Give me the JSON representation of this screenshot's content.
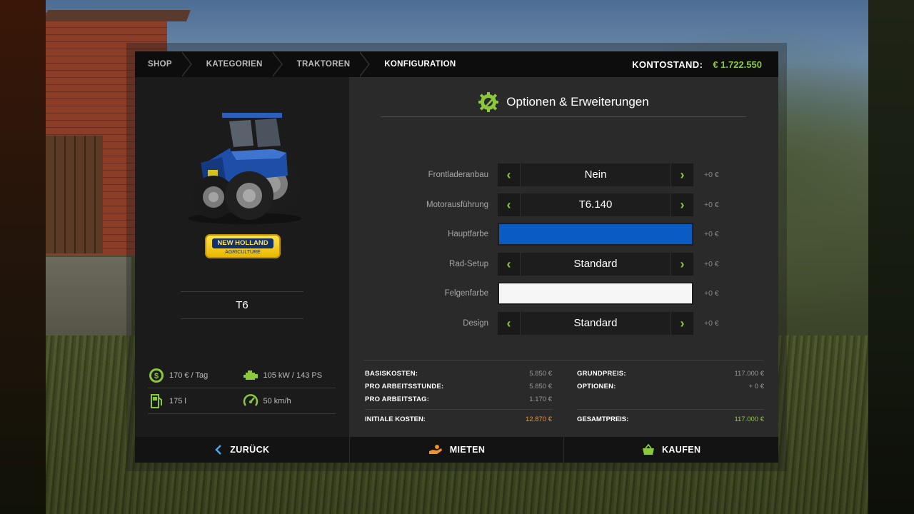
{
  "breadcrumbs": [
    "SHOP",
    "KATEGORIEN",
    "TRAKTOREN",
    "KONFIGURATION"
  ],
  "balance": {
    "label": "KONTOSTAND:",
    "value": "€ 1.722.550"
  },
  "vehicle": {
    "brand_line1": "NEW HOLLAND",
    "brand_line2": "AGRICULTURE",
    "model": "T6",
    "specs": {
      "cost_per_day": "170 € / Tag",
      "power": "105 kW / 143 PS",
      "fuel": "175 l",
      "speed": "50 km/h"
    }
  },
  "options": {
    "title": "Optionen & Erweiterungen",
    "rows": [
      {
        "label": "Frontladeranbau",
        "value": "Nein",
        "price": "+0 €"
      },
      {
        "label": "Motorausführung",
        "value": "T6.140",
        "price": "+0 €"
      },
      {
        "label": "Hauptfarbe",
        "color": "#0a5bc4",
        "price": "+0 €"
      },
      {
        "label": "Rad-Setup",
        "value": "Standard",
        "price": "+0 €"
      },
      {
        "label": "Felgenfarbe",
        "color": "#f6f6f6",
        "price": "+0 €"
      },
      {
        "label": "Design",
        "value": "Standard",
        "price": "+0 €"
      }
    ]
  },
  "costs": {
    "left": [
      {
        "k": "BASISKOSTEN:",
        "v": "5.850 €"
      },
      {
        "k": "PRO ARBEITSSTUNDE:",
        "v": "5.850 €"
      },
      {
        "k": "PRO ARBEITSTAG:",
        "v": "1.170 €"
      }
    ],
    "right": [
      {
        "k": "GRUNDPREIS:",
        "v": "117.000 €"
      },
      {
        "k": "OPTIONEN:",
        "v": "+ 0 €"
      }
    ],
    "initial_label": "INITIALE KOSTEN:",
    "initial_value": "12.870 €",
    "total_label": "GESAMTPREIS:",
    "total_value": "117.000 €"
  },
  "buttons": {
    "back": "ZURÜCK",
    "lease": "MIETEN",
    "buy": "KAUFEN"
  },
  "colors": {
    "accent": "#8cc83c",
    "orange": "#f0932b",
    "main_color": "#0a5bc4",
    "rim_color": "#f6f6f6"
  },
  "icons": {
    "options": "wrench-gear-icon",
    "cost": "dollar-gear-icon",
    "power": "engine-icon",
    "fuel": "fuel-pump-icon",
    "speed": "speedometer-icon",
    "back": "chevron-left-icon",
    "lease": "lease-hand-icon",
    "buy": "shopping-basket-icon"
  }
}
